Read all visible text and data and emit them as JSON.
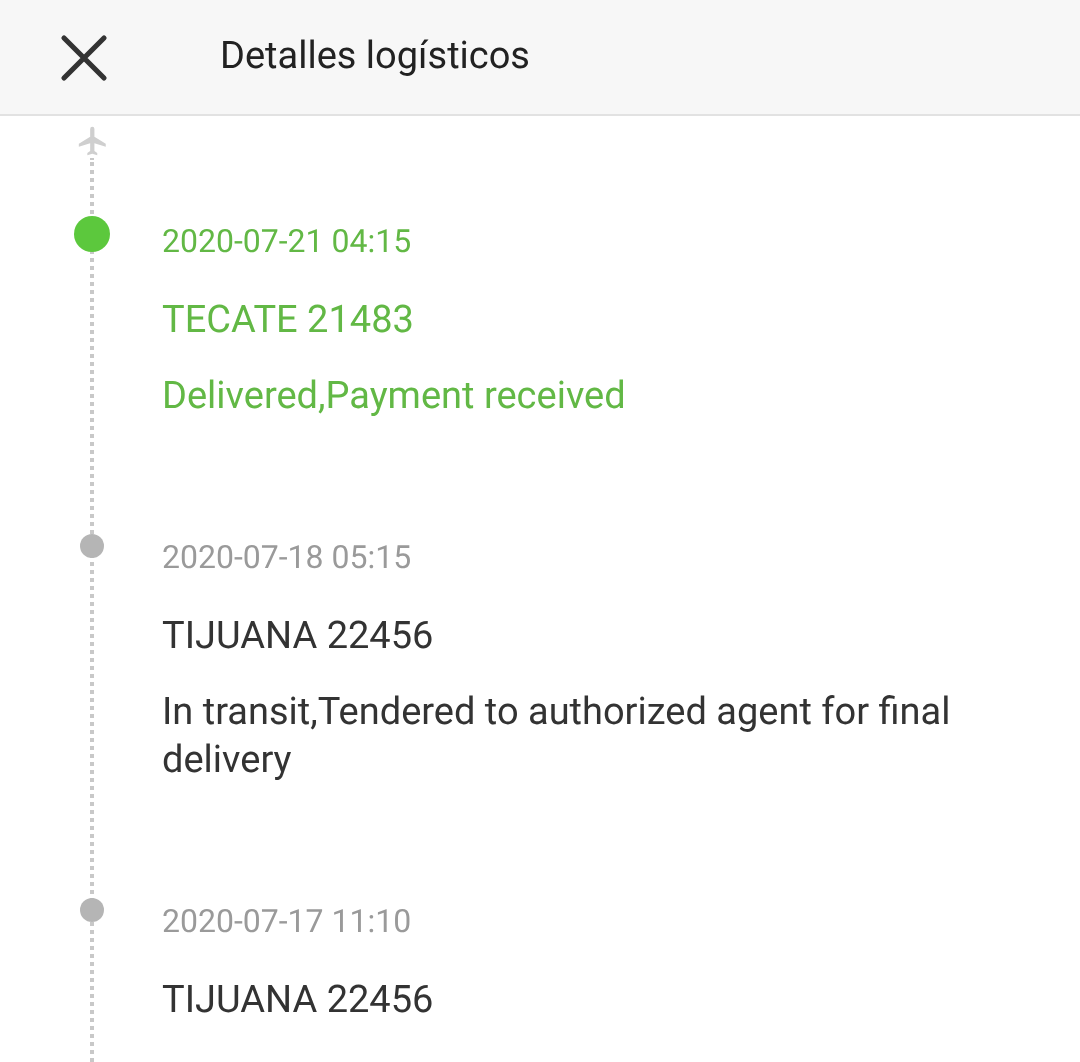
{
  "header": {
    "title": "Detalles logísticos"
  },
  "events": [
    {
      "time": "2020-07-21 04:15",
      "location": "TECATE 21483",
      "status": "Delivered,Payment received",
      "current": true
    },
    {
      "time": "2020-07-18 05:15",
      "location": "TIJUANA 22456",
      "status": "In transit,Tendered to authorized agent for final delivery",
      "current": false
    },
    {
      "time": "2020-07-17 11:10",
      "location": "TIJUANA 22456",
      "current": false
    }
  ]
}
